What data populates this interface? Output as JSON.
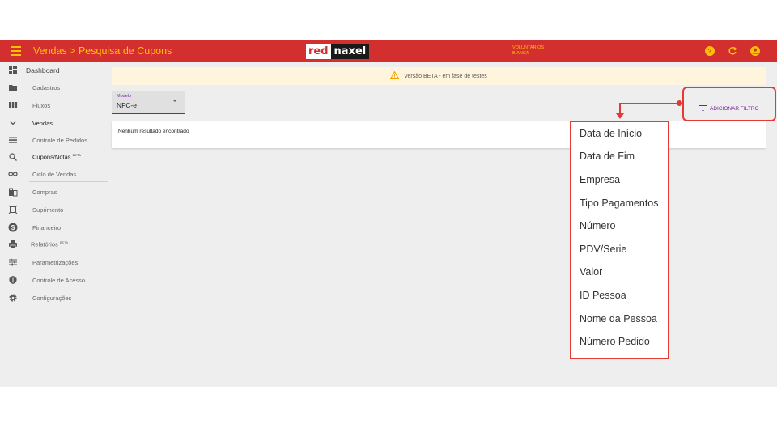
{
  "topbar": {
    "title": "Vendas > Pesquisa de Cupons",
    "logo_red": "red",
    "logo_naxel": "naxel",
    "user_line1": "VOLUNTARIOS",
    "user_line2": "BIANCA",
    "icons": [
      "menu-icon",
      "help-icon",
      "refresh-icon",
      "account-icon"
    ],
    "accent_color": "#ffc107",
    "bar_color": "#d32f2f"
  },
  "sidebar": {
    "items": [
      {
        "label": "Dashboard",
        "icon": "dashboard-icon"
      },
      {
        "label": "Cadastros",
        "icon": "folder-icon"
      },
      {
        "label": "Fluxos",
        "icon": "columns-icon"
      },
      {
        "label": "Vendas",
        "icon": "chevron-down-icon"
      },
      {
        "label": "Controle de Pedidos",
        "icon": "list-icon"
      },
      {
        "label": "Cupons/Notas",
        "badge": "BETA",
        "icon": "search-receipt-icon"
      },
      {
        "label": "Ciclo de Vendas",
        "icon": "infinity-icon"
      },
      {
        "label": "Compras",
        "icon": "building-icon"
      },
      {
        "label": "Suprimento",
        "icon": "supply-icon"
      },
      {
        "label": "Financeiro",
        "icon": "money-icon"
      },
      {
        "label": "Relatórios",
        "badge": "BETA",
        "icon": "print-icon"
      },
      {
        "label": "Parametrizações",
        "icon": "sliders-icon"
      },
      {
        "label": "Controle de Acesso",
        "icon": "shield-icon"
      },
      {
        "label": "Configurações",
        "icon": "gear-icon"
      }
    ]
  },
  "banner": {
    "text": "Versão BETA - em fase de testes",
    "icon": "warning-icon"
  },
  "model_select": {
    "label": "Modelo",
    "value": "NFC-e"
  },
  "results": {
    "empty_text": "Nenhum resultado encontrado"
  },
  "filter_button": {
    "label": "ADICIONAR FILTRO",
    "icon": "filter-icon"
  },
  "filter_menu": {
    "items": [
      "Data de Início",
      "Data de Fim",
      "Empresa",
      "Tipo Pagamentos",
      "Número",
      "PDV/Serie",
      "Valor",
      "ID Pessoa",
      "Nome da Pessoa",
      "Número Pedido"
    ]
  }
}
